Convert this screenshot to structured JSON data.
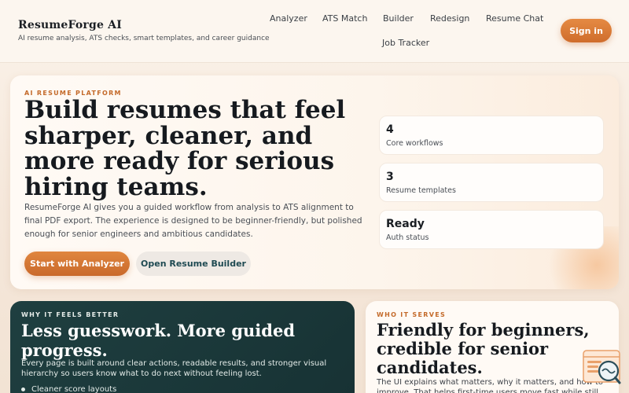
{
  "brand": {
    "name": "ResumeForge AI",
    "tagline": "AI resume analysis, ATS checks, smart templates, and career guidance"
  },
  "nav": {
    "items": [
      "Analyzer",
      "ATS Match",
      "Builder",
      "Redesign",
      "Resume Chat",
      "Job Tracker"
    ]
  },
  "header": {
    "signin_label": "Sign in"
  },
  "hero": {
    "eyebrow": "AI RESUME PLATFORM",
    "title": "Build resumes that feel sharper, cleaner, and more ready for serious hiring teams.",
    "description": "ResumeForge AI gives you a guided workflow from analysis to ATS alignment to final PDF export. The experience is designed to be beginner-friendly, but polished enough for senior engineers and ambitious candidates.",
    "primary_cta": "Start with Analyzer",
    "secondary_cta": "Open Resume Builder",
    "stats": [
      {
        "value": "4",
        "label": "Core workflows"
      },
      {
        "value": "3",
        "label": "Resume templates"
      },
      {
        "value": "Ready",
        "label": "Auth status"
      }
    ]
  },
  "why": {
    "eyebrow": "WHY IT FEELS BETTER",
    "title": "Less guesswork. More guided progress.",
    "description": "Every page is built around clear actions, readable results, and stronger visual hierarchy so users know what to do next without feeling lost.",
    "bullets": [
      "Cleaner score layouts"
    ]
  },
  "who": {
    "eyebrow": "WHO IT SERVES",
    "title": "Friendly for beginners, credible for senior candidates.",
    "description": "The UI explains what matters, why it matters, and how to improve. That helps first-time users move fast while still"
  },
  "icons": {
    "assistant": "search-document-icon"
  },
  "colors": {
    "accent": "#d77a36",
    "dark_card": "#1f3f40",
    "secondary_button_text": "#1f4a52"
  }
}
